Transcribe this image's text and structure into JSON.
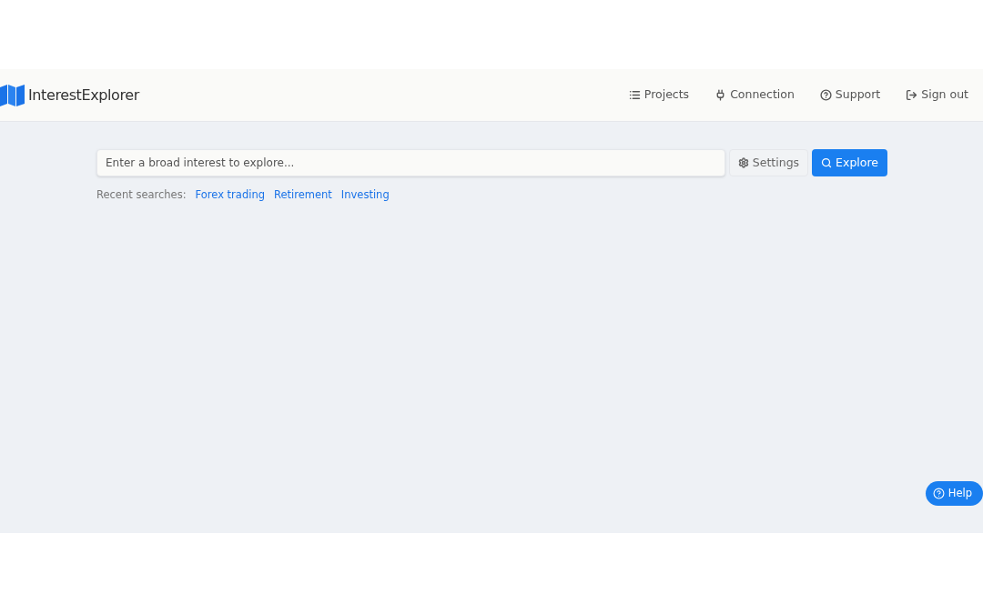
{
  "brand": {
    "name": "InterestExplorer"
  },
  "nav": [
    {
      "label": "Projects",
      "kind": "list"
    },
    {
      "label": "Connection",
      "kind": "plug"
    },
    {
      "label": "Support",
      "kind": "question"
    },
    {
      "label": "Sign out",
      "kind": "signout"
    }
  ],
  "search": {
    "placeholder": "Enter a broad interest to explore..."
  },
  "settings_button": "Settings",
  "explore_button": "Explore",
  "recent": {
    "label": "Recent searches:",
    "items": [
      "Forex trading",
      "Retirement",
      "Investing"
    ]
  },
  "help_button": "Help"
}
